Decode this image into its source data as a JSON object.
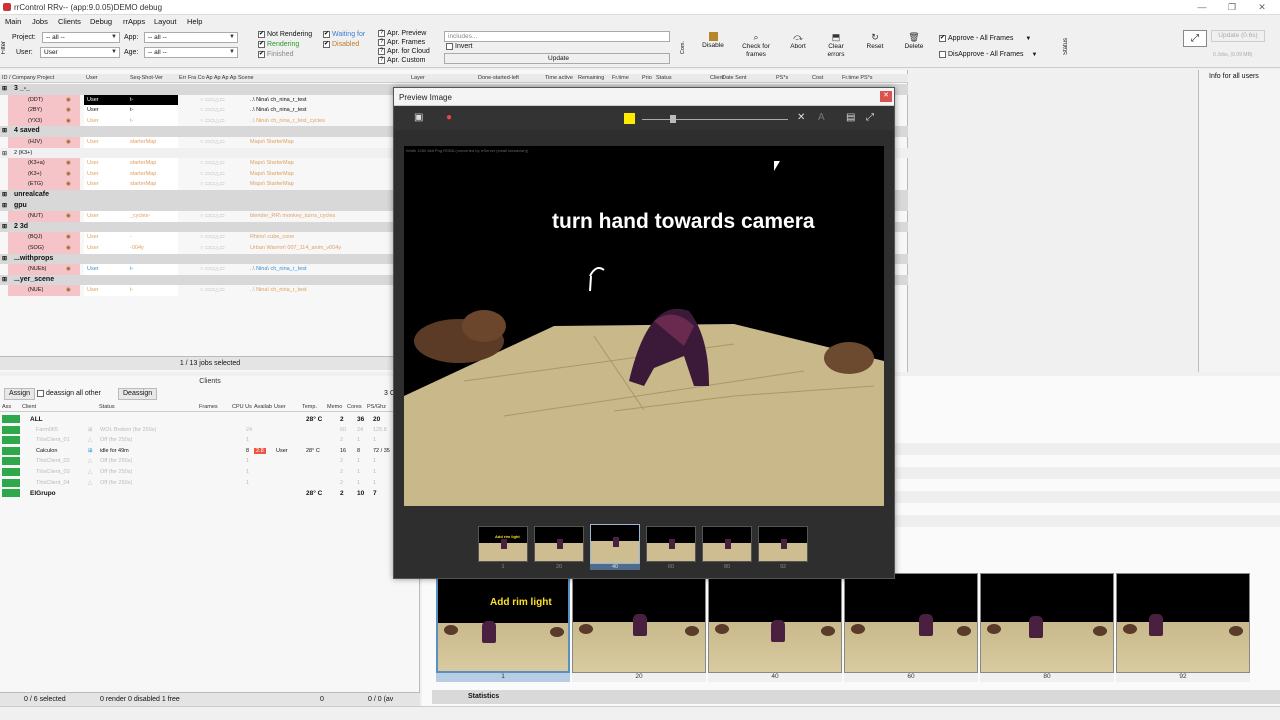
{
  "window": {
    "title": "rrControl  RRv-- (app:9.0.05)DEMO debug"
  },
  "menu": [
    "Main",
    "Jobs",
    "Clients",
    "Debug",
    "rrApps",
    "Layout",
    "Help"
  ],
  "filters": {
    "filter_side_label": "Filter",
    "project_label": "Project:",
    "project_value": "-- all --",
    "app_label": "App:",
    "app_value": "-- all --",
    "user_label": "User:",
    "user_value": "User",
    "age_label": "Age:",
    "age_value": "-- all --",
    "checks": [
      {
        "label": "Not Rendering",
        "checked": true
      },
      {
        "label": "Rendering",
        "checked": true
      },
      {
        "label": "Finished",
        "checked": true
      },
      {
        "label": "Waiting for",
        "checked": true
      },
      {
        "label": "Disabled",
        "checked": true
      }
    ],
    "apr": [
      "Apr. Preview",
      "Apr. Frames",
      "Apr. for Cloud",
      "Apr. Custom"
    ],
    "includes_placeholder": "includes...",
    "invert_label": "Invert",
    "update_label": "Update"
  },
  "toolbar": {
    "com_label": "Com.",
    "buttons": [
      "Disable",
      "Check for frames",
      "Abort",
      "Clear errors",
      "Reset",
      "Delete"
    ],
    "approve": "Approve - All Frames",
    "disapprove": "DisApprove - All Frames",
    "status_side": "Status",
    "update_btn": "Update (0.6s)",
    "update_sub": "0 Jobs, (0.09 MB)"
  },
  "jobs": {
    "headers": [
      "ID / Company Project",
      "User",
      "Seq-Shot-Ver",
      "Err Fra Co Ap Ap Ap Ap Scene",
      "Layer",
      "Done-started-left",
      "Time active",
      "Remaining",
      "Fr.time",
      "Prio",
      "Status",
      "Client",
      "Date Sent",
      "PS*s",
      "Cost",
      "Fr.time PS*s"
    ],
    "rows": [
      {
        "kind": "group",
        "label": "3  _-_"
      },
      {
        "id": "(DDT)",
        "user": "User",
        "seq": "t-",
        "scene": "..\\  Nina\\  ch_nina_r_test",
        "sel": true
      },
      {
        "id": "(2BY)",
        "user": "User",
        "seq": "t-",
        "scene": "..\\  Nina\\  ch_nina_r_test"
      },
      {
        "id": "(YX3)",
        "user": "User",
        "seq": "t-",
        "scene": "..\\  Nina\\  ch_nina_r_test_cycles",
        "faint": true
      },
      {
        "kind": "group",
        "label": "4  saved"
      },
      {
        "id": "(HJV)",
        "user": "User",
        "seq": "starterMap",
        "scene": "Maps\\  StarterMap",
        "faint": true
      },
      {
        "kind": "sub",
        "label": "2  (K3+)"
      },
      {
        "id": "(K3+a)",
        "user": "User",
        "seq": "starterMap",
        "scene": "Maps\\  StarterMap",
        "faint": true
      },
      {
        "id": "(K3+)",
        "user": "User",
        "seq": "starterMap",
        "scene": "Maps\\  StarterMap",
        "faint": true
      },
      {
        "id": "(ETG)",
        "user": "User",
        "seq": "starterMap",
        "scene": "Maps\\  StarterMap",
        "faint": true
      },
      {
        "kind": "group",
        "label": "unrealcafe"
      },
      {
        "kind": "group",
        "label": "gpu"
      },
      {
        "id": "(NUT)",
        "user": "User",
        "seq": "_cycles-",
        "scene": "blender_RR\\  monkey_turns_cycles",
        "faint": true
      },
      {
        "kind": "group",
        "label": "2  3d"
      },
      {
        "id": "(BQJ)",
        "user": "User",
        "seq": "-",
        "scene": "Rhino\\  cube_cone",
        "faint": true
      },
      {
        "id": "(SOG)",
        "user": "User",
        "seq": "-004y",
        "scene": "Urban Warrior\\  007_114_anim_v004y",
        "faint": true
      },
      {
        "kind": "group",
        "label": "...withprops"
      },
      {
        "id": "(NUEb)",
        "user": "User",
        "seq": "t-",
        "scene": "..\\  Nina\\  ch_nina_r_test",
        "blue": true
      },
      {
        "kind": "group",
        "label": "...yer_scene"
      },
      {
        "id": "(NUE)",
        "user": "User",
        "seq": "t-",
        "scene": "..\\  Nina\\  ch_nina_r_test",
        "faint": true
      }
    ],
    "footer": "1 /  13 jobs selected",
    "info_header": "Info for all users"
  },
  "clients": {
    "title": "Clients",
    "assign": "Assign",
    "deassign_all": "deassign all other",
    "deassign": "Deassign",
    "side_num": "3 C",
    "headers": [
      "Ass",
      "Client",
      "Status",
      "Frames",
      "CPU Us",
      "Availab",
      "User",
      "Temp.",
      "Memo",
      "Cores",
      "PS/Ghz"
    ],
    "rows": [
      {
        "name": "ALL",
        "status": "",
        "temp": "28° C",
        "mem": "2",
        "cores": "36",
        "ps": "20",
        "bold": true
      },
      {
        "name": "Farm065",
        "status": "WOL Broken (for 250s)",
        "cpu": "24",
        "mem": "60",
        "cores": "24",
        "ps": "125.8",
        "faint": true
      },
      {
        "name": "ThisClient_01",
        "status": "Off    (for 250s)",
        "cpu": "1",
        "mem": "2",
        "cores": "1",
        "ps": "1",
        "faint": true
      },
      {
        "name": "Calculon",
        "status": "idle for 49m",
        "cpu": "8",
        "avail": "2.8",
        "user": "User",
        "temp": "28° C",
        "mem": "16",
        "cores": "8",
        "ps": "72 / 35"
      },
      {
        "name": "ThisClient_02",
        "status": "Off    (for 250s)",
        "cpu": "1",
        "mem": "2",
        "cores": "1",
        "ps": "1",
        "faint": true
      },
      {
        "name": "ThisClient_03",
        "status": "Off    (for 250s)",
        "cpu": "1",
        "mem": "2",
        "cores": "1",
        "ps": "1",
        "faint": true
      },
      {
        "name": "ThisClient_04",
        "status": "Off    (for 250s)",
        "cpu": "1",
        "mem": "2",
        "cores": "1",
        "ps": "1",
        "faint": true
      },
      {
        "name": "ElGrupo",
        "status": "",
        "temp": "28° C",
        "mem": "2",
        "cores": "10",
        "ps": "7",
        "bold": true
      }
    ],
    "footer_selected": "0 / 6 selected",
    "footer_render": "0 render  0 disabled  1 free",
    "footer_num": "0",
    "footer_av": "0 / 0 (av"
  },
  "preview": {
    "title": "Preview Image",
    "meta": "Width 1080  8bit  Png RGBA      (converted by rrServer (small slowdown))",
    "caption": "turn hand towards camera",
    "thumb_caption": "Add rim light",
    "thumbs": [
      "1",
      "20",
      "40",
      "60",
      "80",
      "92"
    ],
    "selected_index": 2
  },
  "strip": {
    "caption": "Add rim light",
    "frames": [
      "1",
      "20",
      "40",
      "60",
      "80",
      "92"
    ],
    "selected_index": 0
  },
  "stats_label": "Statistics",
  "colors": {
    "accent": "#5a8fc4",
    "group_pink": "#f5c4c8",
    "client_green": "#2ea84a",
    "caption_yellow": "#ffe02a"
  }
}
